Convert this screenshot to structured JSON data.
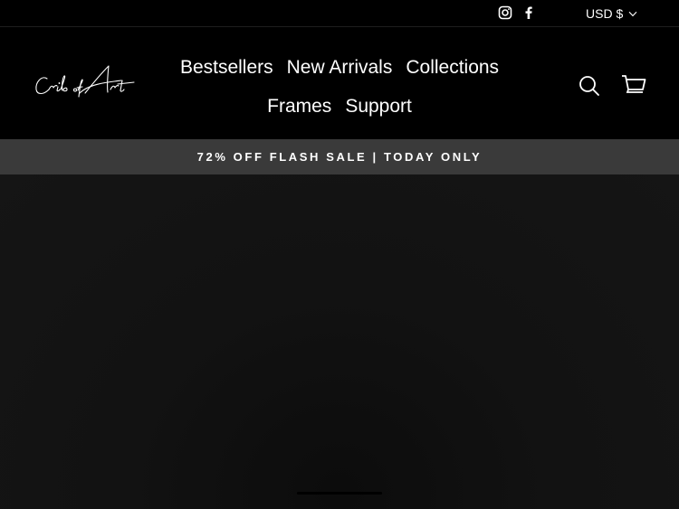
{
  "topbar": {
    "social": [
      {
        "icon": "instagram-icon",
        "label": "Instagram"
      },
      {
        "icon": "facebook-icon",
        "label": "Facebook"
      }
    ],
    "currency": "USD $"
  },
  "header": {
    "logo_text": "Crib of Art",
    "nav_rows": [
      [
        "Bestsellers",
        "New Arrivals",
        "Collections"
      ],
      [
        "Frames",
        "Support"
      ]
    ],
    "search_icon": "search-icon",
    "cart_icon": "cart-icon"
  },
  "announcement": {
    "text": "72% OFF FLASH SALE | TODAY ONLY"
  },
  "colors": {
    "background": "#000000",
    "announcement_bg": "#3a3a3a",
    "hero_bg": "#131313",
    "text": "#ffffff"
  }
}
